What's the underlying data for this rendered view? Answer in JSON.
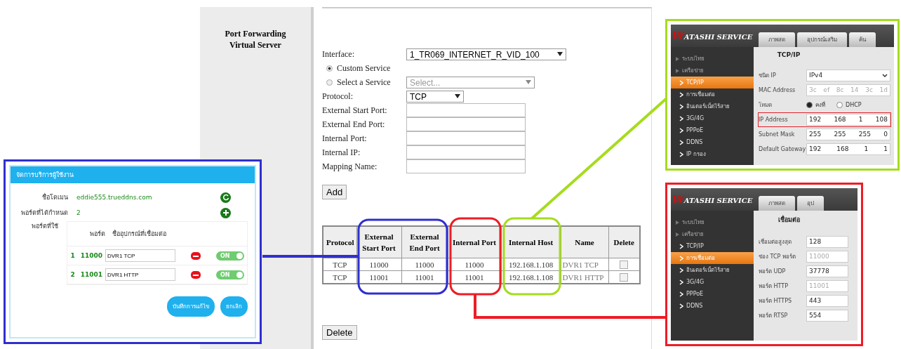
{
  "sidebar": {
    "title_lines": [
      "Port Forwarding",
      "Virtual Server"
    ]
  },
  "form": {
    "fields": [
      {
        "kind": "select",
        "label": "Interface:",
        "value": "1_TR069_INTERNET_R_VID_100"
      },
      {
        "kind": "radio",
        "label": "Custom Service",
        "selected": true
      },
      {
        "kind": "radio-select",
        "label": "Select a Service",
        "selected": false,
        "placeholder": "Select..."
      },
      {
        "kind": "small-select",
        "label": "Protocol:",
        "value": "TCP"
      },
      {
        "kind": "input",
        "label": "External Start Port:"
      },
      {
        "kind": "input",
        "label": "External End Port:"
      },
      {
        "kind": "input",
        "label": "Internal Port:"
      },
      {
        "kind": "input",
        "label": "Internal IP:"
      },
      {
        "kind": "input",
        "label": "Mapping Name:"
      }
    ],
    "add_button": "Add"
  },
  "table": {
    "columns": [
      "Protocol",
      "External Start Port",
      "External End Port",
      "Internal Port",
      "Internal Host",
      "Name",
      "Delete"
    ],
    "rows": [
      {
        "cells": [
          "TCP",
          "11000",
          "11000",
          "11000",
          "192.168.1.108",
          "DVR1 TCP"
        ],
        "checked": false
      },
      {
        "cells": [
          "TCP",
          "11001",
          "11001",
          "11001",
          "192.168.1.108",
          "DVR1 HTTP"
        ],
        "checked": false
      }
    ],
    "delete_button": "Delete"
  },
  "callouts": [
    {
      "kind": "mobile-app",
      "color": "#2f2fd0",
      "header": "จัดการบริการผู้ใช้งาน",
      "domain_label": "ชื่อโดเมน",
      "domain": "eddie555.trueddns.com",
      "count_label": "พอร์ตที่ได้กำหนด",
      "count": "2",
      "ports_label": "พอร์ตที่ใช้",
      "columns": [
        "พอร์ต",
        "ชื่ออุปกรณ์ที่เชื่อมต่อ"
      ],
      "ports": [
        {
          "index": "1",
          "port": "11000",
          "name": "DVR1 TCP",
          "on": true,
          "toggle": "ON"
        },
        {
          "index": "2",
          "port": "11001",
          "name": "DVR1 HTTP",
          "on": true,
          "toggle": "ON"
        }
      ],
      "buttons": [
        "บันทึกการแก้ไข",
        "ยกเลิก"
      ]
    },
    {
      "kind": "dvr",
      "color": "#a6dc1e",
      "logo": "WATASHI SERVICE",
      "tabs": [
        "ภาพสด",
        "อุปกรณ์เสริม",
        "ค้น"
      ],
      "menu": [
        {
          "label": "ระบบไทย",
          "group": true,
          "selected": false
        },
        {
          "label": "เครือข่าย",
          "group": true,
          "selected": false
        },
        {
          "label": "TCP/IP",
          "group": false,
          "selected": true
        },
        {
          "label": "การเชื่อมต่อ",
          "group": false,
          "selected": false
        },
        {
          "label": "อินเตอร์เน็ตไร้สาย",
          "group": false,
          "selected": false
        },
        {
          "label": "3G/4G",
          "group": false,
          "selected": false
        },
        {
          "label": "PPPoE",
          "group": false,
          "selected": false
        },
        {
          "label": "DDNS",
          "group": false,
          "selected": false
        },
        {
          "label": "IP กรอง",
          "group": false,
          "selected": false
        }
      ],
      "panel_title": "TCP/IP",
      "rows": [
        {
          "kind": "select",
          "label": "ชนิด IP",
          "values": [
            "IPv4"
          ],
          "highlighted": false
        },
        {
          "kind": "octets",
          "label": "MAC Address",
          "values": [
            "3c",
            "ef",
            "8c",
            "14",
            "3c",
            "1d"
          ],
          "disabled": true,
          "highlighted": false
        },
        {
          "kind": "radio",
          "label": "โหมด",
          "values": [
            "คงที่",
            "DHCP"
          ],
          "highlighted": false
        },
        {
          "kind": "octets",
          "label": "IP Address",
          "values": [
            "192",
            "168",
            "1",
            "108"
          ],
          "disabled": false,
          "highlighted": true
        },
        {
          "kind": "octets",
          "label": "Subnet Mask",
          "values": [
            "255",
            "255",
            "255",
            "0"
          ],
          "disabled": false,
          "highlighted": false
        },
        {
          "kind": "octets",
          "label": "Default Gateway",
          "values": [
            "192",
            "168",
            "1",
            "1"
          ],
          "disabled": false,
          "highlighted": false
        }
      ]
    },
    {
      "kind": "dvr",
      "color": "#ee1c25",
      "logo": "WATASHI SERVICE",
      "tabs": [
        "ภาพสด",
        "อุป"
      ],
      "menu": [
        {
          "label": "ระบบไทย",
          "group": true,
          "selected": false
        },
        {
          "label": "เครือข่าย",
          "group": true,
          "selected": false
        },
        {
          "label": "TCP/IP",
          "group": false,
          "selected": false
        },
        {
          "label": "การเชื่อมต่อ",
          "group": false,
          "selected": true
        },
        {
          "label": "อินเตอร์เน็ตไร้สาย",
          "group": false,
          "selected": false
        },
        {
          "label": "3G/4G",
          "group": false,
          "selected": false
        },
        {
          "label": "PPPoE",
          "group": false,
          "selected": false
        },
        {
          "label": "DDNS",
          "group": false,
          "selected": false
        }
      ],
      "panel_title": "เชื่อมต่อ",
      "rows": [
        {
          "kind": "input",
          "label": "เชื่อมต่อสูงสุด",
          "values": [
            "128"
          ],
          "disabled": false,
          "highlighted": false
        },
        {
          "kind": "input",
          "label": "ช่อง TCP พอร์ต",
          "values": [
            "11000"
          ],
          "disabled": true,
          "highlighted": false
        },
        {
          "kind": "input",
          "label": "พอร์ต UDP",
          "values": [
            "37778"
          ],
          "disabled": false,
          "highlighted": false
        },
        {
          "kind": "input",
          "label": "พอร์ต HTTP",
          "values": [
            "11001"
          ],
          "disabled": true,
          "highlighted": false
        },
        {
          "kind": "input",
          "label": "พอร์ต HTTPS",
          "values": [
            "443"
          ],
          "disabled": false,
          "highlighted": false
        },
        {
          "kind": "input",
          "label": "พอร์ต RTSP",
          "values": [
            "554"
          ],
          "disabled": false,
          "highlighted": false
        }
      ]
    }
  ]
}
